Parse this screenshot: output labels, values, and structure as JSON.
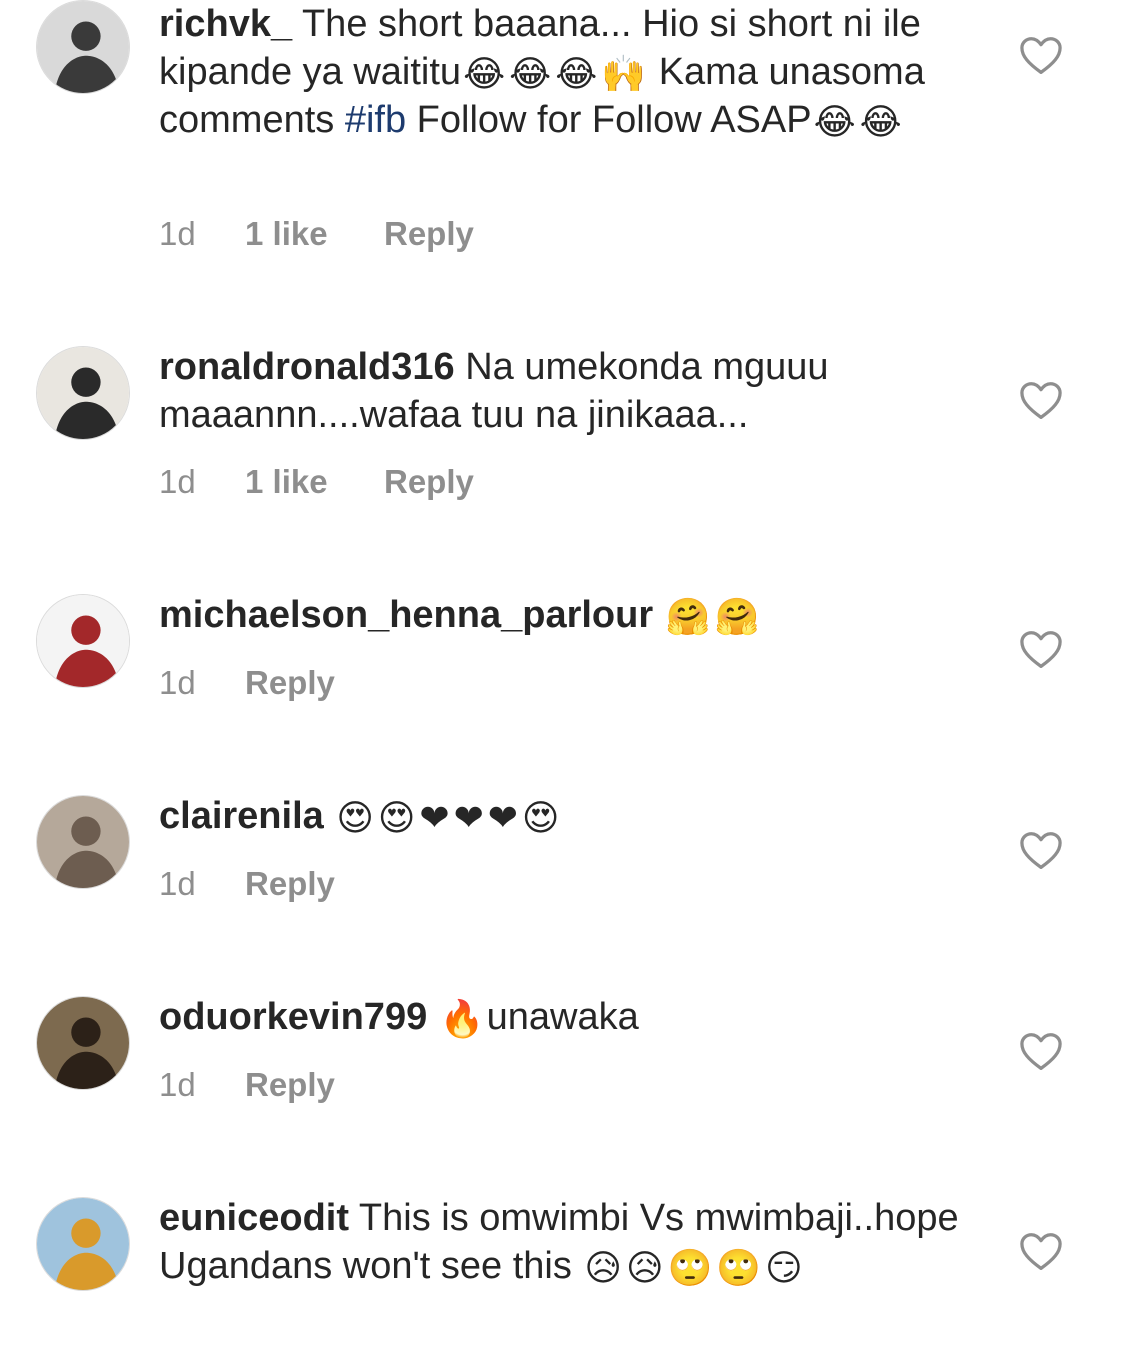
{
  "comments": [
    {
      "username": "richvk_",
      "text_parts": [
        {
          "t": "The short baaana... Hio si short ni ile kipande ya waititu"
        },
        {
          "e": "😂"
        },
        {
          "e": "😂"
        },
        {
          "e": "😂"
        },
        {
          "e": "🙌"
        },
        {
          "t": " Kama unasoma comments "
        },
        {
          "h": "#ifb"
        },
        {
          "t": " Follow for Follow ASAP"
        },
        {
          "e": "😂"
        },
        {
          "e": "😂"
        }
      ],
      "time": "1d",
      "likes": "1 like",
      "reply": "Reply",
      "avatar_colors": [
        "#d9d9d9",
        "#3a3a3a"
      ]
    },
    {
      "username": "ronaldronald316",
      "text_parts": [
        {
          "t": "Na umekonda mguuu maaannn....wafaa tuu na jinikaaa..."
        }
      ],
      "time": "1d",
      "likes": "1 like",
      "reply": "Reply",
      "avatar_colors": [
        "#e9e6e0",
        "#2a2a2a"
      ]
    },
    {
      "username": "michaelson_henna_parlour",
      "text_parts": [
        {
          "e": "🤗"
        },
        {
          "e": "🤗"
        }
      ],
      "time": "1d",
      "likes": "",
      "reply": "Reply",
      "avatar_colors": [
        "#f4f4f4",
        "#a3282a"
      ]
    },
    {
      "username": "clairenila",
      "text_parts": [
        {
          "e": "😍"
        },
        {
          "e": "😍"
        },
        {
          "e": "❤"
        },
        {
          "e": "❤"
        },
        {
          "e": "❤"
        },
        {
          "e": "😍"
        }
      ],
      "time": "1d",
      "likes": "",
      "reply": "Reply",
      "avatar_colors": [
        "#b5a89a",
        "#6d5d50"
      ]
    },
    {
      "username": "oduorkevin799",
      "text_parts": [
        {
          "e": "🔥"
        },
        {
          "t": "unawaka"
        }
      ],
      "time": "1d",
      "likes": "",
      "reply": "Reply",
      "avatar_colors": [
        "#7d6a4f",
        "#2c2118"
      ]
    },
    {
      "username": "euniceodit",
      "text_parts": [
        {
          "t": "This is omwimbi Vs mwimbaji..hope Ugandans won't see this "
        },
        {
          "e": "😥"
        },
        {
          "e": "😥"
        },
        {
          "e": "🙄"
        },
        {
          "e": "🙄"
        },
        {
          "e": "😏"
        }
      ],
      "time": "",
      "likes": "",
      "reply": "",
      "avatar_colors": [
        "#9fc3dd",
        "#d99a2b"
      ]
    }
  ],
  "colors": {
    "text": "#262626",
    "meta": "#8e8e8e",
    "hashtag": "#1d3b6e",
    "heart_outline": "#8e8e8e"
  },
  "icons": {
    "like": "heart-outline-icon"
  }
}
